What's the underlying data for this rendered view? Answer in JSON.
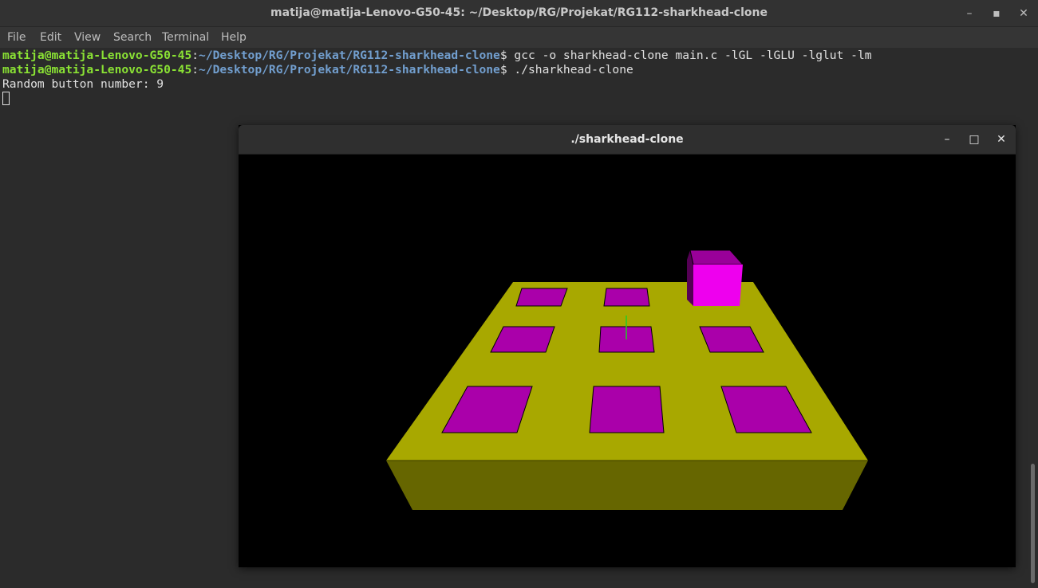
{
  "terminal": {
    "title": "matija@matija-Lenovo-G50-45: ~/Desktop/RG/Projekat/RG112-sharkhead-clone",
    "window_buttons": {
      "minimize": "–",
      "maximize": "▪",
      "close": "✕"
    },
    "menu": [
      {
        "label": "File"
      },
      {
        "label": "Edit"
      },
      {
        "label": "View"
      },
      {
        "label": "Search"
      },
      {
        "label": "Terminal"
      },
      {
        "label": "Help"
      }
    ],
    "lines": [
      {
        "user": "matija@matija-Lenovo-G50-45",
        "colon": ":",
        "path": "~/Desktop/RG/Projekat/RG112-sharkhead-clone",
        "dollar": "$",
        "command": " gcc -o sharkhead-clone main.c -lGL -lGLU -lglut -lm"
      },
      {
        "user": "matija@matija-Lenovo-G50-45",
        "colon": ":",
        "path": "~/Desktop/RG/Projekat/RG112-sharkhead-clone",
        "dollar": "$",
        "command": " ./sharkhead-clone"
      }
    ],
    "output": "Random button number: 9",
    "colors": {
      "prompt_user": "#8ae234",
      "prompt_path": "#729fcf",
      "text": "#e0e0e0",
      "background": "#2b2b2b"
    }
  },
  "gl_window": {
    "title": "./sharkhead-clone",
    "window_buttons": {
      "minimize": "–",
      "maximize": "□",
      "close": "✕"
    },
    "scene": {
      "board_color": "#a8a800",
      "board_side_color": "#666600",
      "button_color": "#aa00aa",
      "cube_color": "#ee00ee",
      "marker_color": "#22cc22",
      "button_grid": "3x3",
      "cube_position": "back-right"
    }
  }
}
